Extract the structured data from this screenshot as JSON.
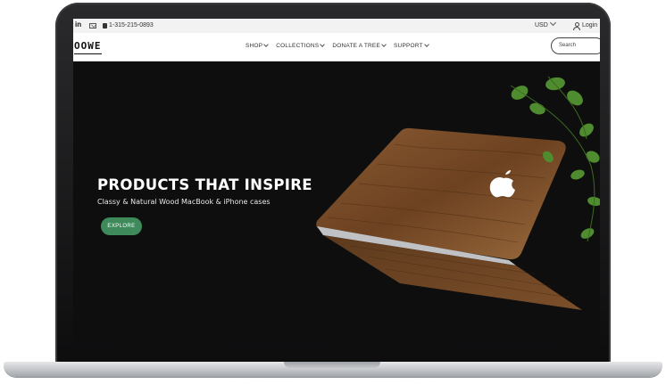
{
  "topbar": {
    "social_icon": "in",
    "phone": "1-315-215-0893",
    "currency": "USD",
    "login": "Login"
  },
  "nav": {
    "logo": "OOWE",
    "menu": [
      {
        "label": "SHOP"
      },
      {
        "label": "COLLECTIONS"
      },
      {
        "label": "DONATE A TREE"
      },
      {
        "label": "SUPPORT"
      }
    ],
    "search_placeholder": "Search"
  },
  "hero": {
    "title": "PRODUCTS THAT INSPIRE",
    "subtitle": "Classy & Natural Wood MacBook & iPhone cases",
    "cta": "EXPLORE"
  },
  "colors": {
    "hero_bg": "#0e0e0e",
    "cta_green": "#3e8a5b",
    "wood": "#7a4a26",
    "leaf": "#4f8c2f"
  },
  "icons": [
    "linkedin-icon",
    "mail-icon",
    "phone-icon",
    "chevron-down-icon",
    "user-icon",
    "apple-logo-icon"
  ]
}
